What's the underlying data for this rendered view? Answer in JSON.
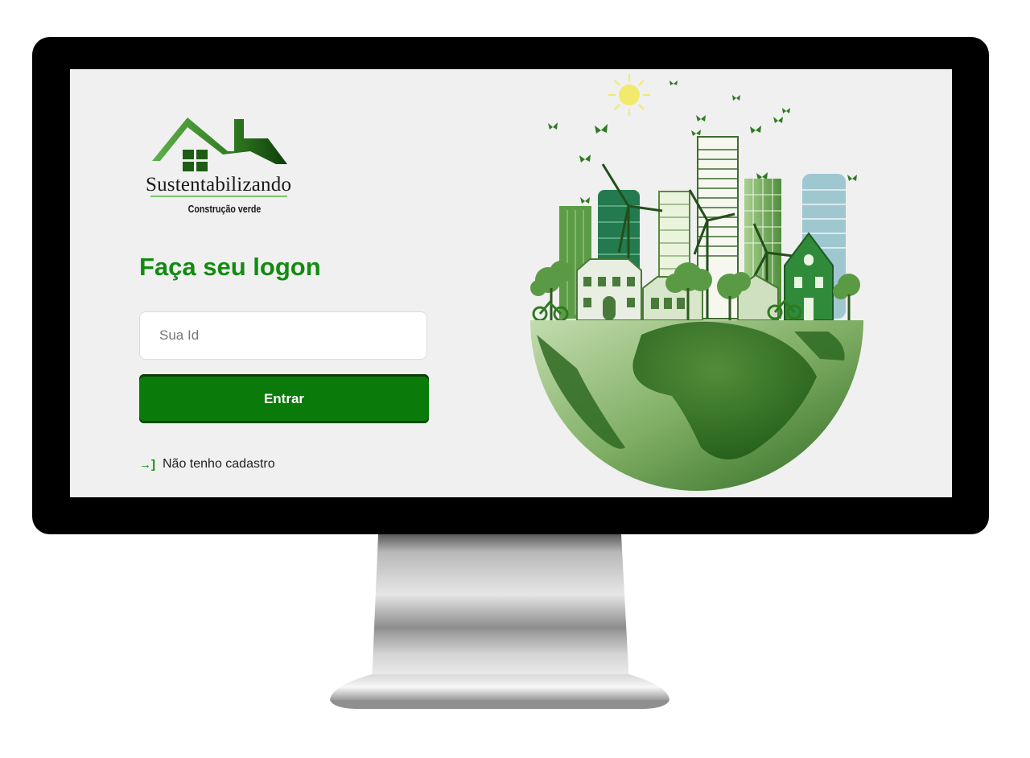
{
  "brand": {
    "name": "Sustentabilizando",
    "tagline": "Construção verde"
  },
  "login": {
    "title": "Faça seu logon",
    "id_placeholder": "Sua Id",
    "submit_label": "Entrar",
    "register_link": "Não tenho cadastro"
  },
  "colors": {
    "primary_green": "#0a7a0a",
    "title_green": "#138a13",
    "screen_background": "#f0f0f0",
    "frame": "#000000"
  },
  "icons": {
    "register": "log-in-icon",
    "logo": "house-icon",
    "illustration": "green-city-globe"
  }
}
